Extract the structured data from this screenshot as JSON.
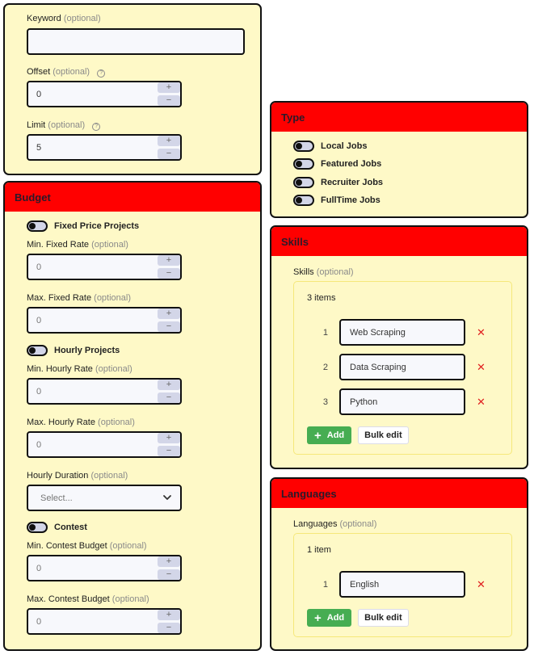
{
  "search": {
    "keyword": {
      "label": "Keyword",
      "optional": "(optional)",
      "value": ""
    },
    "offset": {
      "label": "Offset",
      "optional": "(optional)",
      "help": "?",
      "value": "0"
    },
    "limit": {
      "label": "Limit",
      "optional": "(optional)",
      "help": "?",
      "value": "5"
    }
  },
  "stepper": {
    "plus": "+",
    "minus": "−"
  },
  "budget": {
    "title": "Budget",
    "fixed_toggle": {
      "label": "Fixed Price Projects",
      "on": false
    },
    "min_fixed": {
      "label": "Min. Fixed Rate",
      "optional": "(optional)",
      "value": "0"
    },
    "max_fixed": {
      "label": "Max. Fixed Rate",
      "optional": "(optional)",
      "value": "0"
    },
    "hourly_toggle": {
      "label": "Hourly Projects",
      "on": false
    },
    "min_hourly": {
      "label": "Min. Hourly Rate",
      "optional": "(optional)",
      "value": "0"
    },
    "max_hourly": {
      "label": "Max. Hourly Rate",
      "optional": "(optional)",
      "value": "0"
    },
    "hourly_duration": {
      "label": "Hourly Duration",
      "optional": "(optional)",
      "placeholder": "Select..."
    },
    "contest_toggle": {
      "label": "Contest",
      "on": false
    },
    "min_contest": {
      "label": "Min. Contest Budget",
      "optional": "(optional)",
      "value": "0"
    },
    "max_contest": {
      "label": "Max. Contest Budget",
      "optional": "(optional)",
      "value": "0"
    }
  },
  "type": {
    "title": "Type",
    "toggles": [
      {
        "label": "Local Jobs",
        "on": false
      },
      {
        "label": "Featured Jobs",
        "on": false
      },
      {
        "label": "Recruiter Jobs",
        "on": false
      },
      {
        "label": "FullTime Jobs",
        "on": false
      }
    ]
  },
  "skills": {
    "title": "Skills",
    "label": "Skills",
    "optional": "(optional)",
    "count": "3 items",
    "items": [
      {
        "index": "1",
        "value": "Web Scraping"
      },
      {
        "index": "2",
        "value": "Data Scraping"
      },
      {
        "index": "3",
        "value": "Python"
      }
    ],
    "add_label": "Add",
    "bulk_label": "Bulk edit"
  },
  "languages": {
    "title": "Languages",
    "label": "Languages",
    "optional": "(optional)",
    "count": "1 item",
    "items": [
      {
        "index": "1",
        "value": "English"
      }
    ],
    "add_label": "Add",
    "bulk_label": "Bulk edit"
  },
  "icons": {
    "delete": "✕",
    "add": "+"
  },
  "colors": {
    "header": "#ff0000",
    "card_bg": "#fef9c7",
    "add_button": "#46ad52",
    "delete": "#e02020"
  }
}
